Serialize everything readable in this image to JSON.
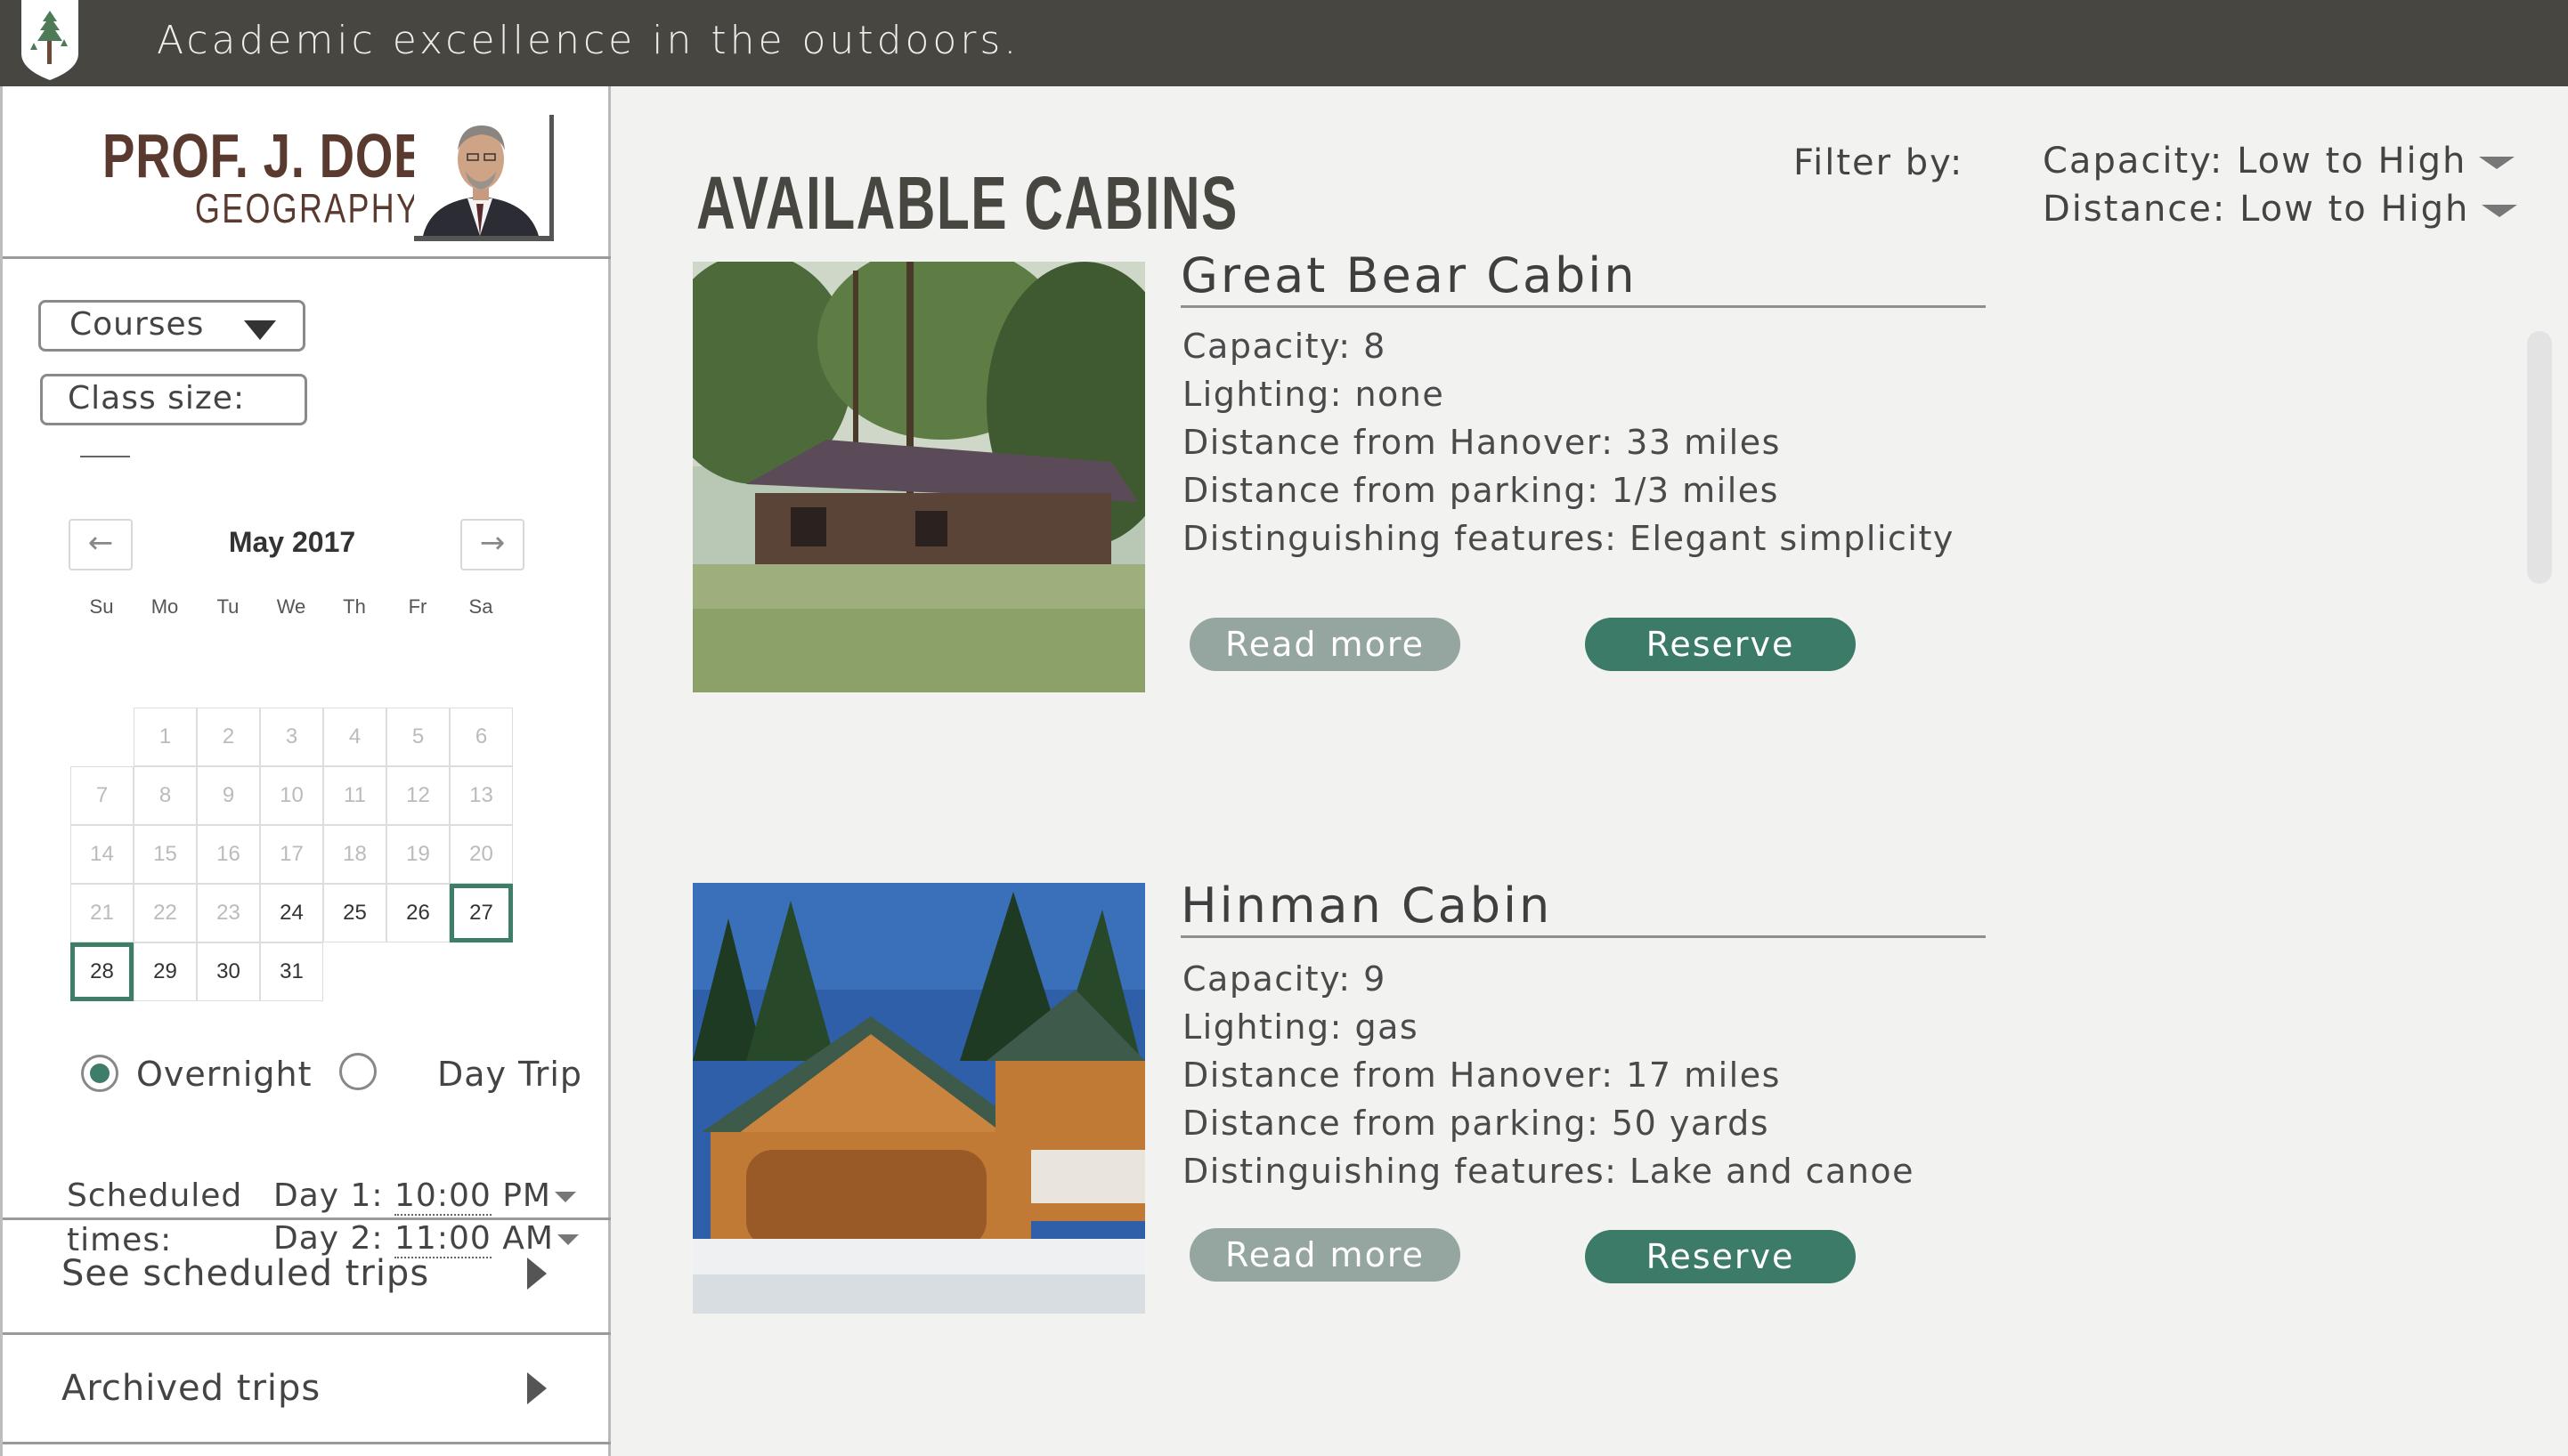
{
  "header": {
    "tagline": "Academic excellence in the outdoors."
  },
  "profile": {
    "name": "PROF. J. DOE",
    "department": "GEOGRAPHY"
  },
  "controls": {
    "courses_label": "Courses",
    "class_size_label": "Class size:"
  },
  "calendar": {
    "month_label": "May 2017",
    "prev_icon": "←",
    "next_icon": "→",
    "weekdays": [
      "Su",
      "Mo",
      "Tu",
      "We",
      "Th",
      "Fr",
      "Sa"
    ],
    "days": {
      "1": "1",
      "2": "2",
      "3": "3",
      "4": "4",
      "5": "5",
      "6": "6",
      "7": "7",
      "8": "8",
      "9": "9",
      "10": "10",
      "11": "11",
      "12": "12",
      "13": "13",
      "14": "14",
      "15": "15",
      "16": "16",
      "17": "17",
      "18": "18",
      "19": "19",
      "20": "20",
      "21": "21",
      "22": "22",
      "23": "23",
      "24": "24",
      "25": "25",
      "26": "26",
      "27": "27",
      "28": "28",
      "29": "29",
      "30": "30",
      "31": "31"
    },
    "selected_days": [
      "27",
      "28"
    ]
  },
  "trip_type": {
    "overnight_label": "Overnight",
    "daytrip_label": "Day Trip",
    "selected": "Overnight"
  },
  "schedule": {
    "label_line1": "Scheduled",
    "label_line2": "times:",
    "day1_prefix": "Day 1:",
    "day1_time": "10:00",
    "day1_ampm": "PM",
    "day2_prefix": "Day 2:",
    "day2_time": "11:00",
    "day2_ampm": "AM"
  },
  "side_links": {
    "scheduled": "See scheduled trips",
    "archived": "Archived trips"
  },
  "main": {
    "title": "AVAILABLE CABINS",
    "filter_label": "Filter by:",
    "filter_capacity": "Capacity: Low to High",
    "filter_distance": "Distance: Low to High"
  },
  "cabins": [
    {
      "name": "Great Bear Cabin",
      "capacity": "Capacity: 8",
      "lighting": "Lighting:  none",
      "distance_hanover": "Distance from Hanover: 33 miles",
      "distance_parking": "Distance from parking: 1/3 miles",
      "features": "Distinguishing features: Elegant simplicity",
      "read_more": "Read more",
      "reserve": "Reserve"
    },
    {
      "name": "Hinman Cabin",
      "capacity": "Capacity: 9",
      "lighting": "Lighting:  gas",
      "distance_hanover": "Distance from Hanover: 17 miles",
      "distance_parking": "Distance from parking: 50 yards",
      "features": "Distinguishing features: Lake and canoe",
      "read_more": "Read more",
      "reserve": "Reserve"
    }
  ],
  "colors": {
    "topbar": "#474641",
    "accent_green": "#3b7b68",
    "read_more_gray": "#95a59f",
    "name_brown": "#5a3a2f"
  }
}
